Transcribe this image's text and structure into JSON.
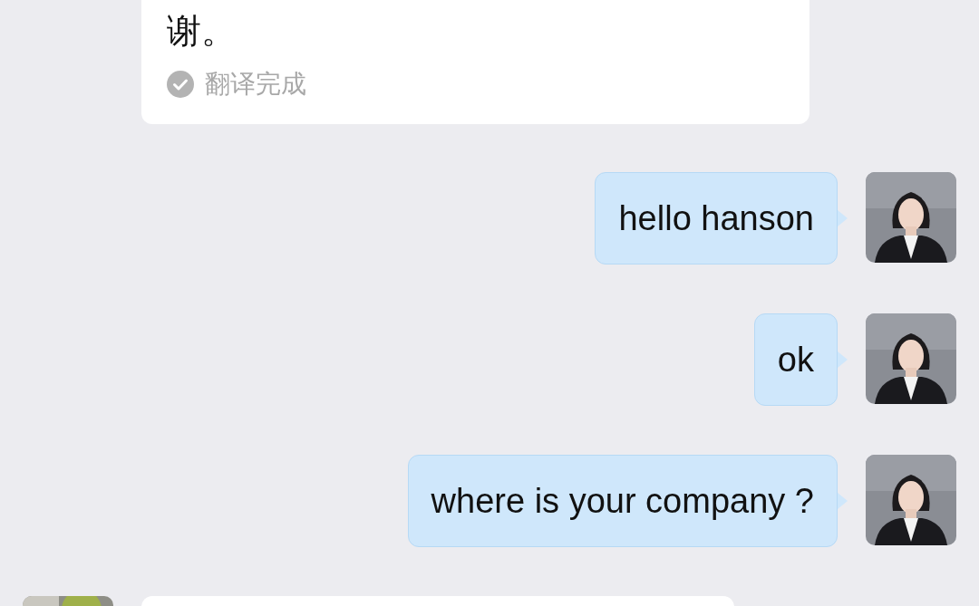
{
  "translation_card": {
    "text": "谢。",
    "status": {
      "text": "翻译完成",
      "done": true
    }
  },
  "messages": [
    {
      "kind": "outgoing",
      "text": "hello hanson"
    },
    {
      "kind": "outgoing",
      "text": "ok"
    },
    {
      "kind": "outgoing",
      "text": "where is your company ?"
    },
    {
      "kind": "incoming"
    }
  ]
}
